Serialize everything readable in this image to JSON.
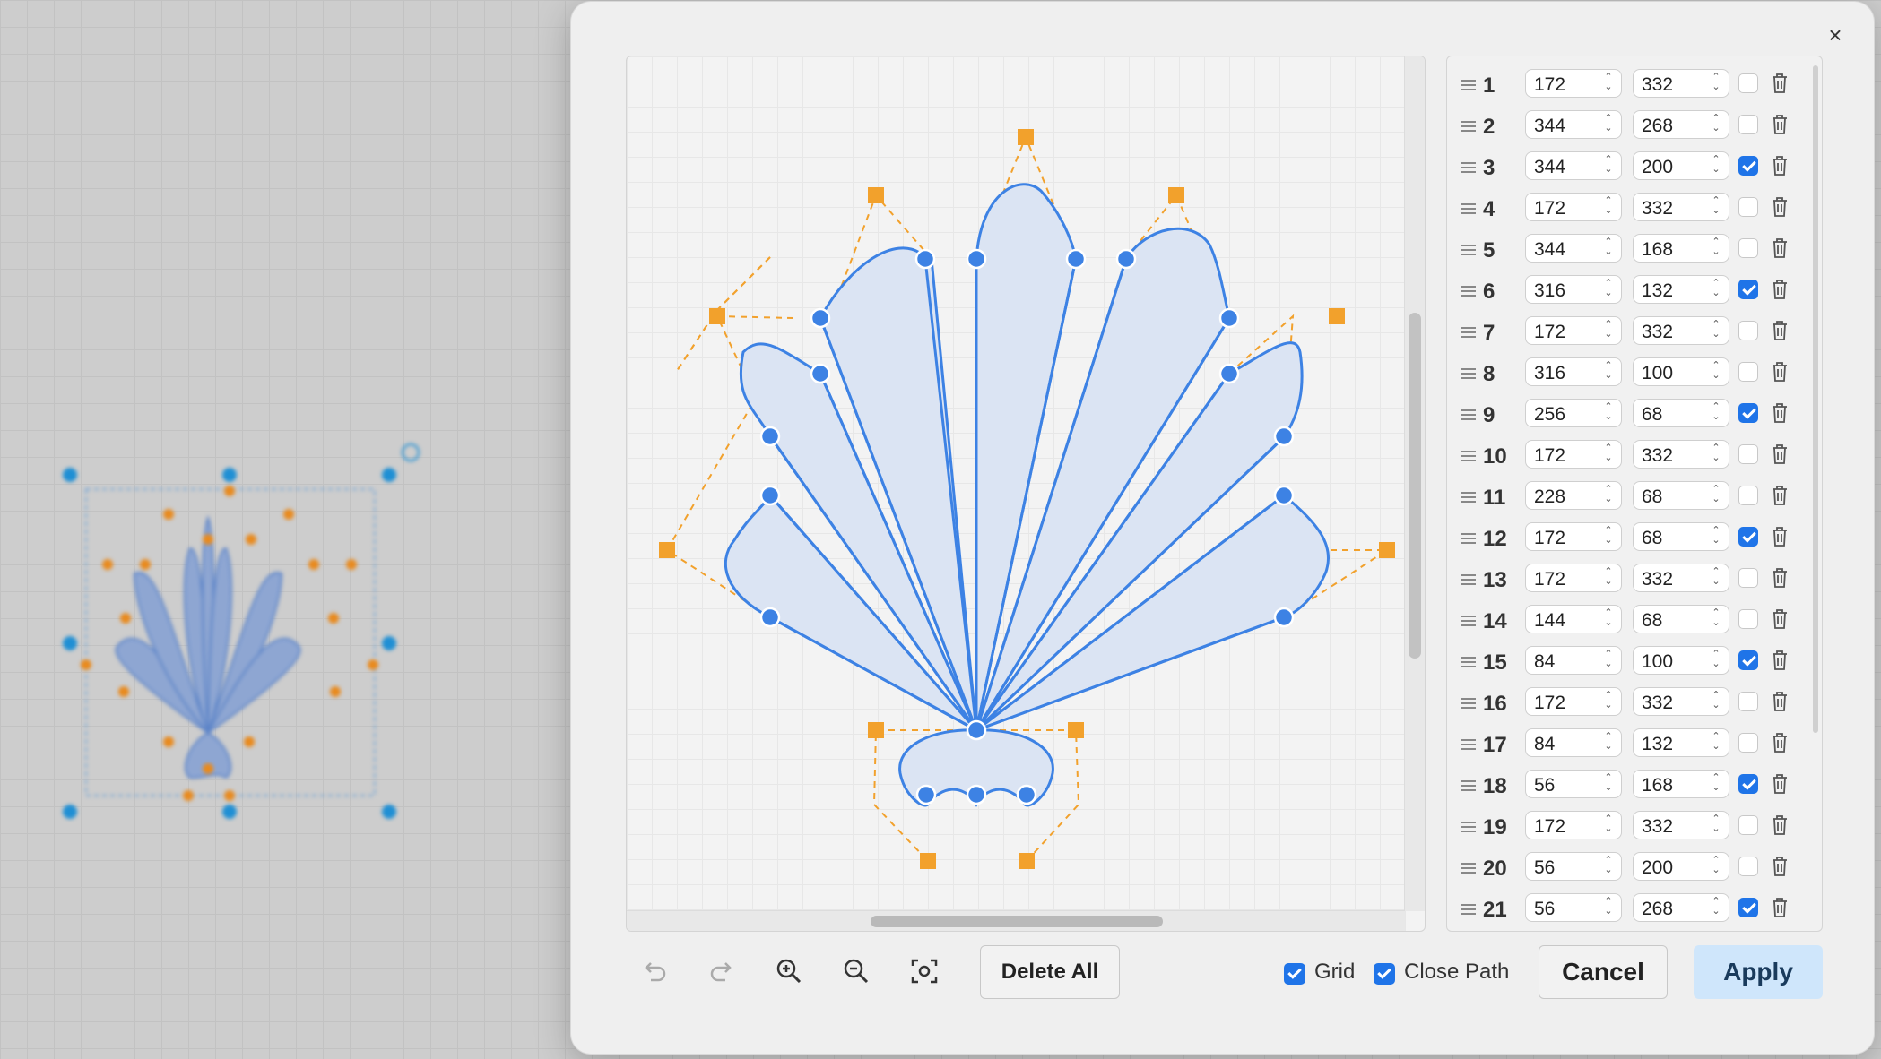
{
  "dialog": {
    "close_label": "×",
    "delete_all_label": "Delete All",
    "grid_label": "Grid",
    "grid_checked": true,
    "close_path_label": "Close Path",
    "close_path_checked": true,
    "cancel_label": "Cancel",
    "apply_label": "Apply"
  },
  "toolbar_icons": [
    "undo-icon",
    "redo-icon",
    "zoom-in-icon",
    "zoom-out-icon",
    "fit-view-icon"
  ],
  "colors": {
    "path_stroke": "#3d82e4",
    "path_fill": "#dbe4f3",
    "anchor": "#3d82e4",
    "control_handle": "#f2a12c",
    "checkbox_on": "#1f74e8",
    "apply_bg": "#cfe6fb"
  },
  "points": [
    {
      "index": "1",
      "x": "172",
      "y": "332",
      "checked": false
    },
    {
      "index": "2",
      "x": "344",
      "y": "268",
      "checked": false
    },
    {
      "index": "3",
      "x": "344",
      "y": "200",
      "checked": true
    },
    {
      "index": "4",
      "x": "172",
      "y": "332",
      "checked": false
    },
    {
      "index": "5",
      "x": "344",
      "y": "168",
      "checked": false
    },
    {
      "index": "6",
      "x": "316",
      "y": "132",
      "checked": true
    },
    {
      "index": "7",
      "x": "172",
      "y": "332",
      "checked": false
    },
    {
      "index": "8",
      "x": "316",
      "y": "100",
      "checked": false
    },
    {
      "index": "9",
      "x": "256",
      "y": "68",
      "checked": true
    },
    {
      "index": "10",
      "x": "172",
      "y": "332",
      "checked": false
    },
    {
      "index": "11",
      "x": "228",
      "y": "68",
      "checked": false
    },
    {
      "index": "12",
      "x": "172",
      "y": "68",
      "checked": true
    },
    {
      "index": "13",
      "x": "172",
      "y": "332",
      "checked": false
    },
    {
      "index": "14",
      "x": "144",
      "y": "68",
      "checked": false
    },
    {
      "index": "15",
      "x": "84",
      "y": "100",
      "checked": true
    },
    {
      "index": "16",
      "x": "172",
      "y": "332",
      "checked": false
    },
    {
      "index": "17",
      "x": "84",
      "y": "132",
      "checked": false
    },
    {
      "index": "18",
      "x": "56",
      "y": "168",
      "checked": true
    },
    {
      "index": "19",
      "x": "172",
      "y": "332",
      "checked": false
    },
    {
      "index": "20",
      "x": "56",
      "y": "200",
      "checked": false
    },
    {
      "index": "21",
      "x": "56",
      "y": "268",
      "checked": true
    }
  ]
}
